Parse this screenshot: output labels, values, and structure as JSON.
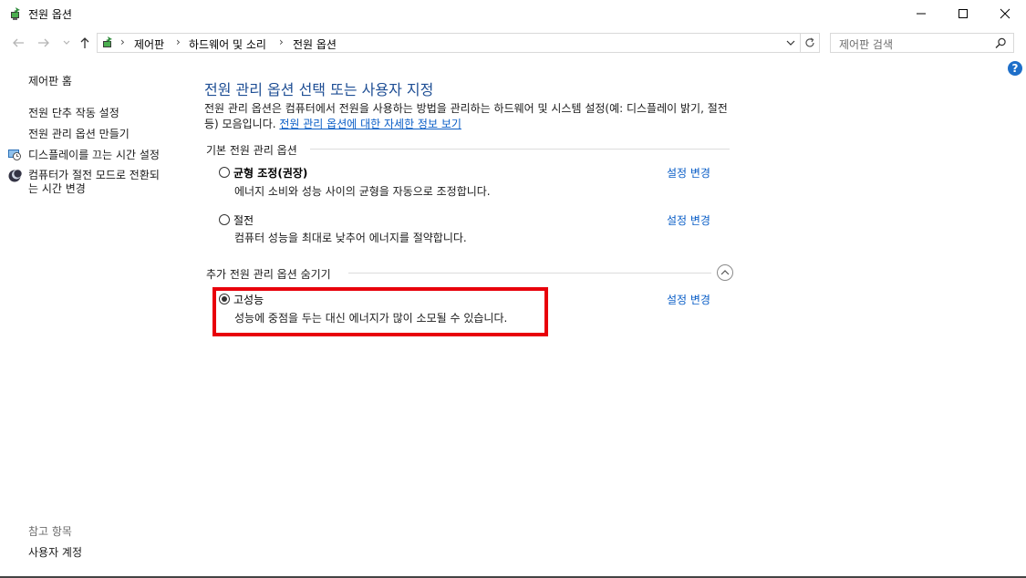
{
  "window": {
    "title": "전원 옵션",
    "minimize_label": "—",
    "maximize_label": "☐",
    "close_label": "✕"
  },
  "address_bar": {
    "breadcrumbs": [
      "제어판",
      "하드웨어 및 소리",
      "전원 옵션"
    ],
    "search_placeholder": "제어판 검색"
  },
  "sidebar": {
    "home": "제어판 홈",
    "items": [
      {
        "label": "전원 단추 작동 설정"
      },
      {
        "label": "전원 관리 옵션 만들기"
      },
      {
        "label": "디스플레이를 끄는 시간 설정"
      },
      {
        "label_line1": "컴퓨터가 절전 모드로 전환되",
        "label_line2": "는 시간 변경"
      }
    ],
    "see_also_heading": "참고 항목",
    "see_also_items": [
      "사용자 계정"
    ]
  },
  "main": {
    "title": "전원 관리 옵션 선택 또는 사용자 지정",
    "description": "전원 관리 옵션은 컴퓨터에서 전원을 사용하는 방법을 관리하는 하드웨어 및 시스템 설정(예: 디스플레이 밝기, 절전 등) 모음입니다. ",
    "description_link": "전원 관리 옵션에 대한 자세한 정보 보기",
    "preferred_group": "기본 전원 관리 옵션",
    "plans": [
      {
        "name": "균형 조정(권장)",
        "desc": "에너지 소비와 성능 사이의 균형을 자동으로 조정합니다.",
        "change": "설정 변경"
      },
      {
        "name": "절전",
        "desc": "컴퓨터 성능을 최대로 낮추어 에너지를 절약합니다.",
        "change": "설정 변경"
      }
    ],
    "additional_group": "추가 전원 관리 옵션 숨기기",
    "additional_plans": [
      {
        "name": "고성능",
        "desc": "성능에 중점을 두는 대신 에너지가 많이 소모될 수 있습니다.",
        "change": "설정 변경"
      }
    ],
    "help_label": "?"
  },
  "colors": {
    "title_blue": "#1e4e94",
    "link_blue": "#0a5ec7",
    "highlight_red": "#e8000b"
  }
}
